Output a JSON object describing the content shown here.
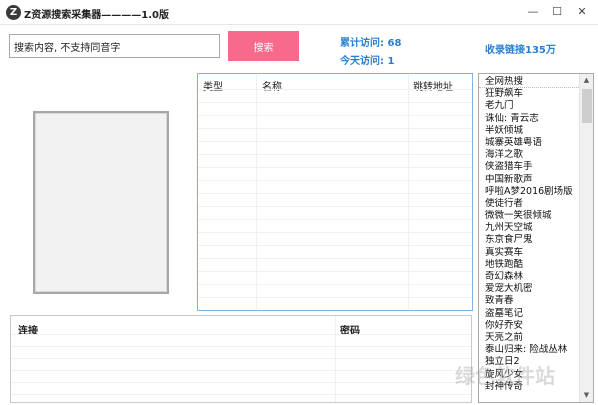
{
  "window": {
    "icon_letter": "Z",
    "title": "Z资源搜索采集器————1.0版",
    "min_glyph": "—",
    "max_glyph": "☐",
    "close_glyph": "✕"
  },
  "search": {
    "value": "搜索内容, 不支持同音字",
    "button_label": "搜索"
  },
  "stats": {
    "total_visits": "累计访问: 68",
    "today_visits": "今天访问: 1",
    "links_count": "收录链接135万"
  },
  "results_table": {
    "columns": [
      "类型",
      "名称",
      "跳转地址"
    ]
  },
  "credentials_table": {
    "columns": [
      "连接",
      "密码"
    ]
  },
  "hot_list": {
    "header": "全网热搜",
    "items": [
      "狂野飙车",
      "老九门",
      "诛仙: 青云志",
      "半妖倾城",
      "城寨英雄粤语",
      "海洋之歌",
      "侠盗猎车手",
      "中国新歌声",
      "呼啦A梦2016剧场版",
      "使徒行者",
      "微微一笑很倾城",
      "九州天空城",
      "东京食尸鬼",
      "真实赛车",
      "地铁跑酷",
      "奇幻森林",
      "爱宠大机密",
      "致青春",
      "盗墓笔记",
      "你好乔安",
      "天亮之前",
      "泰山归来: 险战丛林",
      "独立日2",
      "旋风少女",
      "封神传奇"
    ]
  },
  "scrollbar": {
    "up_glyph": "▲",
    "down_glyph": "▼"
  },
  "watermark": "绿色软件站"
}
